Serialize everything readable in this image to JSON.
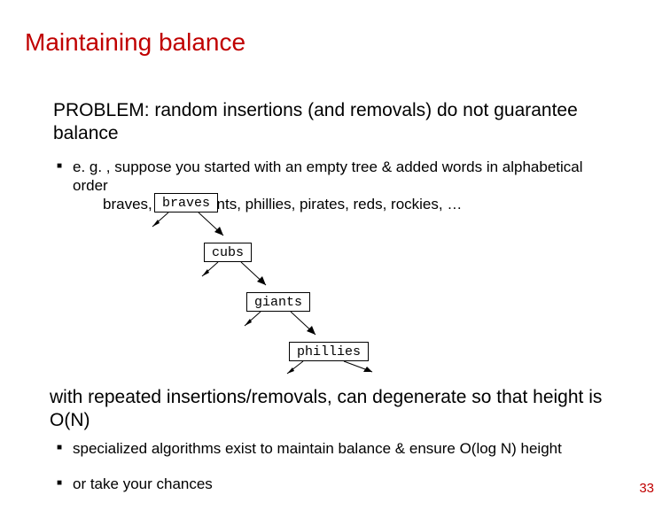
{
  "title": "Maintaining balance",
  "problem": "PROBLEM: random insertions (and removals) do not guarantee balance",
  "bullet1": "e. g. , suppose you started with an empty tree & added words in alphabetical order",
  "example": "braves, cubs, giants, phillies, pirates, reds, rockies, …",
  "nodes": {
    "n0": "braves",
    "n1": "cubs",
    "n2": "giants",
    "n3": "phillies"
  },
  "conclusion": "with repeated insertions/removals, can degenerate so that height is O(N)",
  "bullet2": "specialized algorithms exist to maintain balance & ensure O(log N) height",
  "bullet3": "or take your chances",
  "page_number": "33"
}
